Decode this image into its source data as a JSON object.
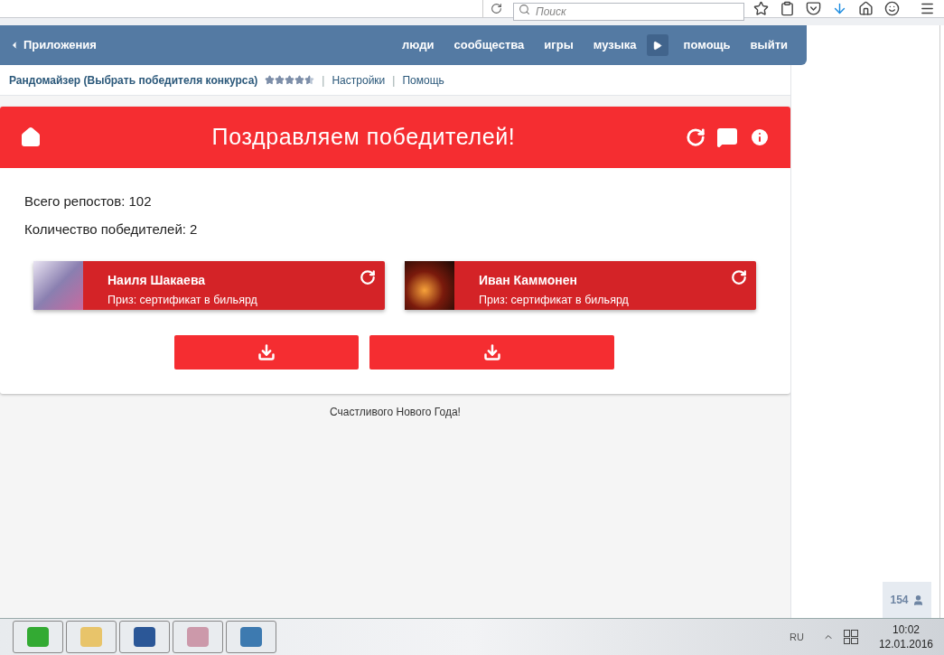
{
  "browser": {
    "search_placeholder": "Поиск"
  },
  "nav": {
    "back_label": "Приложения",
    "links": [
      "люди",
      "сообщества",
      "игры",
      "музыка"
    ],
    "links_after": [
      "помощь",
      "выйти"
    ]
  },
  "app_bar": {
    "title": "Рандомайзер (Выбрать победителя конкурса)",
    "stars": 4.5,
    "separator": "|",
    "links": [
      "Настройки",
      "Помощь"
    ]
  },
  "banner": {
    "title": "Поздравляем победителей!"
  },
  "stats": [
    "Всего репостов: 102",
    "Количество победителей: 2"
  ],
  "winners": [
    {
      "name": "Наиля Шакаева",
      "prize": "Приз: сертификат в бильярд"
    },
    {
      "name": "Иван Каммонен",
      "prize": "Приз: сертификат в бильярд"
    }
  ],
  "footer": "Счастливого Нового Года!",
  "online_badge": "154",
  "taskbar": {
    "lang": "RU",
    "time": "10:02",
    "date": "12.01.2016"
  }
}
